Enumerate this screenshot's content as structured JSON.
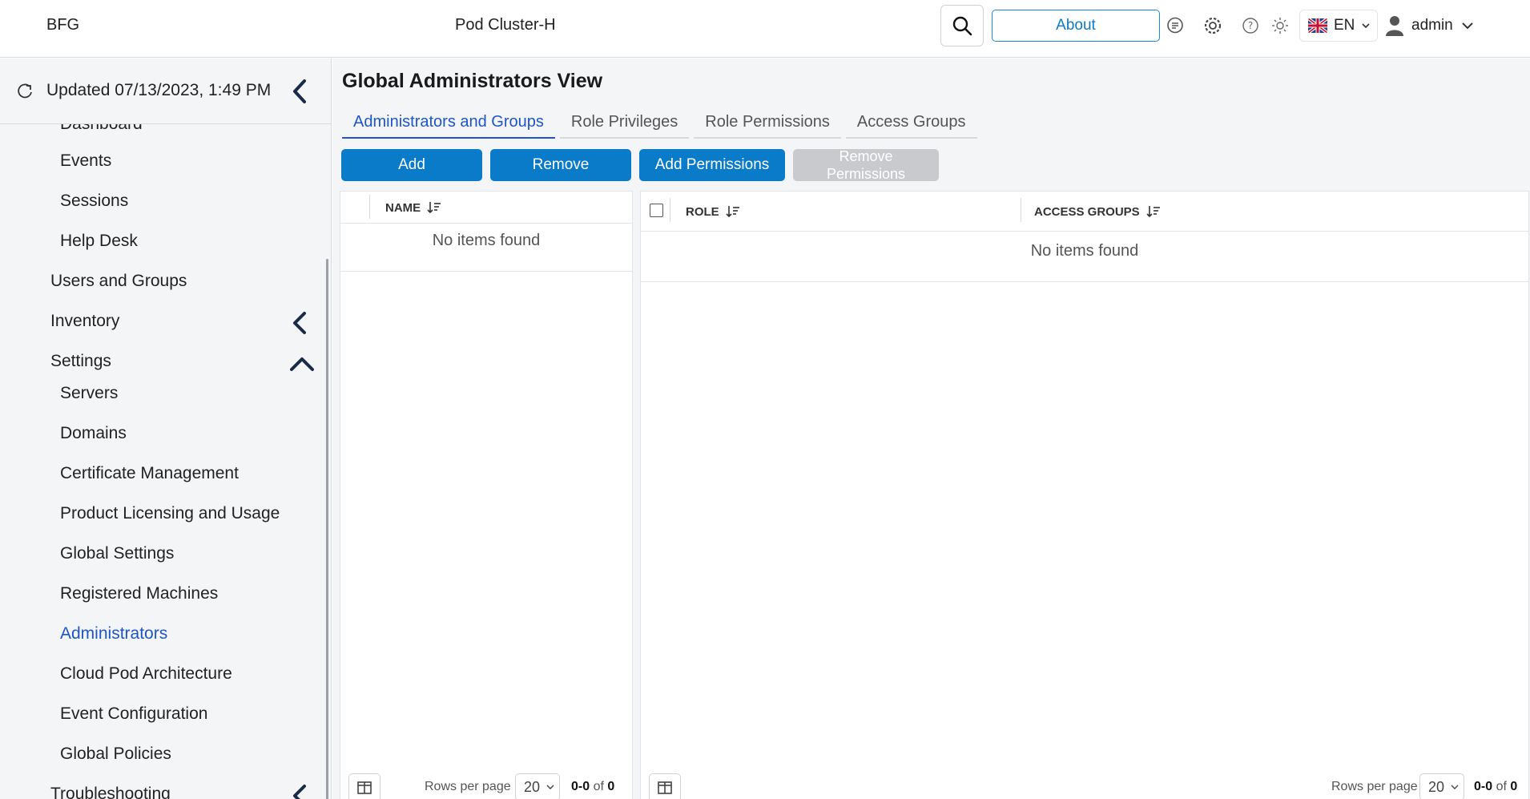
{
  "header": {
    "brand": "BFG",
    "cluster": "Pod Cluster-H",
    "about_label": "About",
    "language": "EN",
    "user": "admin"
  },
  "sidebar": {
    "updated": "Updated 07/13/2023, 1:49 PM",
    "items": [
      {
        "label": "Dashboard"
      },
      {
        "label": "Events"
      },
      {
        "label": "Sessions"
      },
      {
        "label": "Help Desk"
      },
      {
        "label": "Users and Groups"
      },
      {
        "label": "Inventory"
      },
      {
        "label": "Settings"
      },
      {
        "label": "Servers"
      },
      {
        "label": "Domains"
      },
      {
        "label": "Certificate Management"
      },
      {
        "label": "Product Licensing and Usage"
      },
      {
        "label": "Global Settings"
      },
      {
        "label": "Registered Machines"
      },
      {
        "label": "Administrators"
      },
      {
        "label": "Cloud Pod Architecture"
      },
      {
        "label": "Event Configuration"
      },
      {
        "label": "Global Policies"
      },
      {
        "label": "Troubleshooting"
      }
    ]
  },
  "main": {
    "title": "Global Administrators View",
    "tabs": [
      {
        "label": "Administrators and Groups"
      },
      {
        "label": "Role Privileges"
      },
      {
        "label": "Role Permissions"
      },
      {
        "label": "Access Groups"
      }
    ],
    "buttons": {
      "add": "Add",
      "remove": "Remove",
      "add_permissions": "Add Permissions",
      "remove_permissions_1": "Remove",
      "remove_permissions_2": "Permissions"
    },
    "left_table": {
      "columns": [
        "NAME"
      ],
      "empty_text": "No items found",
      "rows_per_page_label": "Rows per page",
      "rows_per_page": "20",
      "range": "0-0",
      "of": "of",
      "total": "0"
    },
    "right_table": {
      "columns": [
        "ROLE",
        "ACCESS GROUPS"
      ],
      "empty_text": "No items found",
      "rows_per_page_label": "Rows per page",
      "rows_per_page": "20",
      "range": "0-0",
      "of": "of",
      "total": "0"
    }
  },
  "colors": {
    "accent": "#0a7bc8",
    "active_link": "#1e55c8",
    "disabled": "#c8cacd"
  }
}
